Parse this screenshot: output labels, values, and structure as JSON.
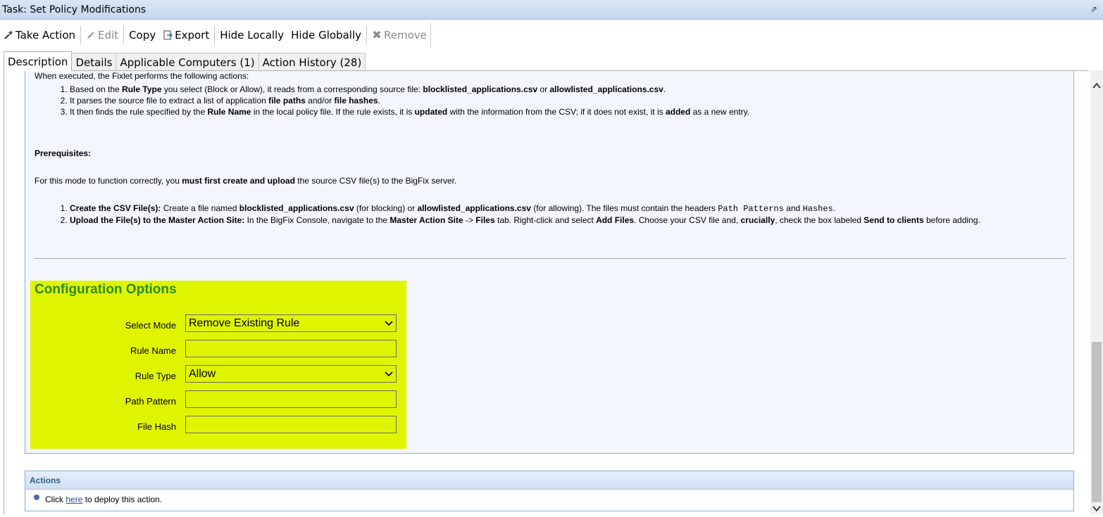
{
  "window": {
    "title": "Task: Set Policy Modifications"
  },
  "toolbar": {
    "take_action": "Take Action",
    "edit": "Edit",
    "copy": "Copy",
    "export": "Export",
    "hide_locally": "Hide Locally",
    "hide_globally": "Hide Globally",
    "remove": "Remove"
  },
  "tabs": [
    {
      "label": "Description"
    },
    {
      "label": "Details"
    },
    {
      "label": "Applicable Computers (1)"
    },
    {
      "label": "Action History (28)"
    }
  ],
  "description": {
    "intro": "When executed, the Fixlet performs the following actions:",
    "steps": [
      {
        "p1": "Based on the ",
        "b1": "Rule Type",
        "p2": " you select (Block or Allow), it reads from a corresponding source file: ",
        "b2": "blocklisted_applications.csv",
        "p3": " or ",
        "b3": "allowlisted_applications.csv",
        "p4": "."
      },
      {
        "p1": "It parses the source file to extract a list of application ",
        "b1": "file paths",
        "p2": " and/or ",
        "b2": "file hashes",
        "p3": "."
      },
      {
        "p1": "It then finds the rule specified by the ",
        "b1": "Rule Name",
        "p2": " in the local policy file. If the rule exists, it is ",
        "b2": "updated",
        "p3": " with the information from the CSV; if it does not exist, it is ",
        "b3": "added",
        "p4": " as a new entry."
      }
    ],
    "prereq_title": "Prerequisites:",
    "prereq_text": {
      "p1": "For this mode to function correctly, you ",
      "b1": "must first create and upload",
      "p2": " the source CSV file(s) to the BigFix server."
    },
    "prereq_steps": [
      {
        "b1": "Create the CSV File(s):",
        "p1": " Create a file named ",
        "b2": "blocklisted_applications.csv",
        "p2": " (for blocking) or ",
        "b3": "allowlisted_applications.csv",
        "p3": " (for allowing). The files must contain the headers ",
        "m1": "Path Patterns",
        "p4": " and ",
        "m2": "Hashes",
        "p5": "."
      },
      {
        "b1": "Upload the File(s) to the Master Action Site:",
        "p1": " In the BigFix Console, navigate to the ",
        "b2": "Master Action Site",
        "p2": " -> ",
        "b3": "Files",
        "p3": " tab. Right-click and select ",
        "b4": "Add Files",
        "p4": ". Choose your CSV file and, ",
        "b5": "crucially",
        "p5": ", check the box labeled ",
        "b6": "Send to clients",
        "p6": " before adding."
      }
    ]
  },
  "config": {
    "title": "Configuration Options",
    "mode_label": "Select Mode",
    "mode_value": "Remove Existing Rule",
    "rule_name_label": "Rule Name",
    "rule_name_value": "",
    "rule_type_label": "Rule Type",
    "rule_type_value": "Allow",
    "path_pattern_label": "Path Pattern",
    "path_pattern_value": "",
    "file_hash_label": "File Hash",
    "file_hash_value": "",
    "background_color": "#dff500",
    "title_color": "#2e8b1a"
  },
  "actions": {
    "header": "Actions",
    "pre": "Click ",
    "link": "here",
    "post": " to deploy this action."
  }
}
